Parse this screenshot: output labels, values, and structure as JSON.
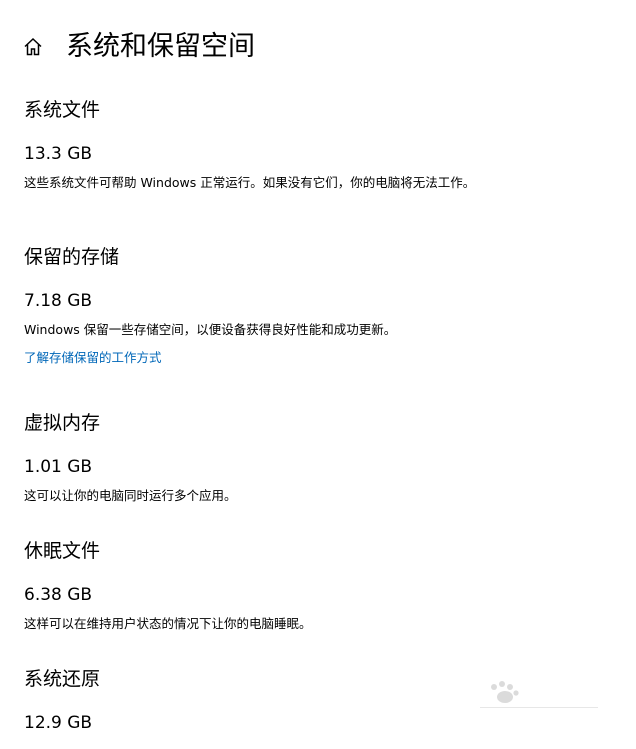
{
  "header": {
    "title": "系统和保留空间",
    "home_icon": "home-icon"
  },
  "sections": [
    {
      "title": "系统文件",
      "size": "13.3 GB",
      "description": "这些系统文件可帮助 Windows 正常运行。如果没有它们，你的电脑将无法工作。"
    },
    {
      "title": "保留的存储",
      "size": "7.18 GB",
      "description": "Windows 保留一些存储空间，以便设备获得良好性能和成功更新。",
      "link": "了解存储保留的工作方式"
    },
    {
      "title": "虚拟内存",
      "size": "1.01 GB",
      "description": "这可以让你的电脑同时运行多个应用。"
    },
    {
      "title": "休眠文件",
      "size": "6.38 GB",
      "description": "这样可以在维持用户状态的情况下让你的电脑睡眠。"
    },
    {
      "title": "系统还原",
      "size": "12.9 GB"
    }
  ],
  "colors": {
    "link": "#0067b8",
    "text": "#000000",
    "background": "#ffffff"
  }
}
